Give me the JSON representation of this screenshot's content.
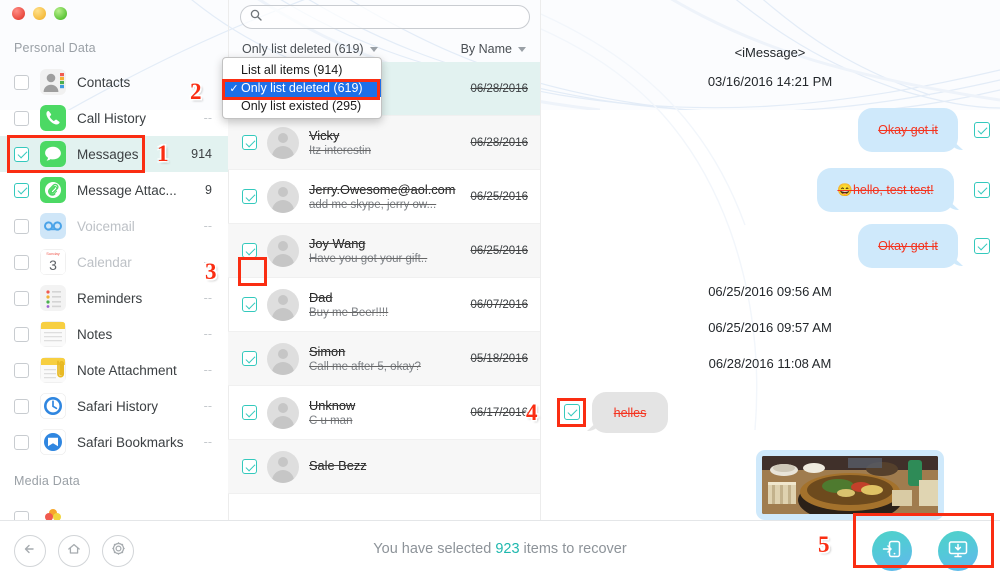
{
  "window": {
    "traffic_lights": [
      "close",
      "minimize",
      "zoom"
    ]
  },
  "sidebar": {
    "sections": [
      {
        "title": "Personal Data"
      },
      {
        "title": "Media Data"
      }
    ],
    "items": [
      {
        "label": "Contacts",
        "count": "",
        "checked": false,
        "dim": false,
        "icon": "contacts-icon"
      },
      {
        "label": "Call History",
        "count": "--",
        "checked": false,
        "dim": false,
        "icon": "call-history-icon"
      },
      {
        "label": "Messages",
        "count": "914",
        "checked": true,
        "dim": false,
        "icon": "messages-icon"
      },
      {
        "label": "Message Attac...",
        "count": "9",
        "checked": true,
        "dim": false,
        "icon": "message-attachment-icon"
      },
      {
        "label": "Voicemail",
        "count": "--",
        "checked": false,
        "dim": true,
        "icon": "voicemail-icon"
      },
      {
        "label": "Calendar",
        "count": "--",
        "checked": false,
        "dim": true,
        "icon": "calendar-icon"
      },
      {
        "label": "Reminders",
        "count": "--",
        "checked": false,
        "dim": false,
        "icon": "reminders-icon"
      },
      {
        "label": "Notes",
        "count": "--",
        "checked": false,
        "dim": false,
        "icon": "notes-icon"
      },
      {
        "label": "Note Attachment",
        "count": "--",
        "checked": false,
        "dim": false,
        "icon": "note-attachment-icon"
      },
      {
        "label": "Safari History",
        "count": "--",
        "checked": false,
        "dim": false,
        "icon": "safari-history-icon"
      },
      {
        "label": "Safari Bookmarks",
        "count": "--",
        "checked": false,
        "dim": false,
        "icon": "safari-bookmarks-icon"
      }
    ]
  },
  "search": {
    "value": "",
    "placeholder": ""
  },
  "filters": {
    "scope_label": "Only list deleted (619)",
    "sort_label": "By Name"
  },
  "dropdown": {
    "items": [
      {
        "label": "List all items (914)",
        "selected": false
      },
      {
        "label": "Only list deleted (619)",
        "selected": true
      },
      {
        "label": "Only list existed (295)",
        "selected": false
      }
    ]
  },
  "message_list": [
    {
      "name": "",
      "preview": "",
      "date": "06/28/2016",
      "checked": true
    },
    {
      "name": "Vicky",
      "preview": "Itz interestin",
      "date": "06/28/2016",
      "checked": true
    },
    {
      "name": "Jerry.Owesome@aol.com",
      "preview": "add me skype, jerry ow...",
      "date": "06/25/2016",
      "checked": true
    },
    {
      "name": "Joy Wang",
      "preview": "Have you got your gift..",
      "date": "06/25/2016",
      "checked": true
    },
    {
      "name": "Dad",
      "preview": "Buy me Beer!!!!",
      "date": "06/07/2016",
      "checked": true
    },
    {
      "name": "Simon",
      "preview": "Call me after 5, okay?",
      "date": "05/18/2016",
      "checked": true
    },
    {
      "name": "Unknow",
      "preview": "C u man",
      "date": "06/17/2016",
      "checked": true
    },
    {
      "name": "Sale Bezz",
      "preview": "",
      "date": "",
      "checked": true
    }
  ],
  "conversation": {
    "header": "<iMessage>",
    "entries": [
      {
        "kind": "timestamp",
        "text": "03/16/2016 14:21 PM"
      },
      {
        "kind": "bubble-out",
        "text": "Okay got it"
      },
      {
        "kind": "bubble-out",
        "text": "😄hello, test test!"
      },
      {
        "kind": "bubble-out",
        "text": "Okay got it"
      },
      {
        "kind": "timestamp",
        "text": "06/25/2016 09:56 AM"
      },
      {
        "kind": "timestamp",
        "text": "06/25/2016 09:57 AM"
      },
      {
        "kind": "timestamp",
        "text": "06/28/2016 11:08 AM"
      },
      {
        "kind": "bubble-in",
        "text": "helles"
      },
      {
        "kind": "photo",
        "text": ""
      }
    ]
  },
  "bottom": {
    "back_icon": "back-arrow-icon",
    "home_icon": "home-icon",
    "settings_icon": "gear-icon",
    "status_prefix": "You have selected ",
    "status_count": "923",
    "status_suffix": " items to recover",
    "recover_to_device_icon": "recover-to-device-icon",
    "recover_to_computer_icon": "recover-to-computer-icon"
  },
  "annotations": [
    {
      "number": "1"
    },
    {
      "number": "2"
    },
    {
      "number": "3"
    },
    {
      "number": "4"
    },
    {
      "number": "5"
    }
  ],
  "colors": {
    "accent_teal": "#1fb8ae",
    "annotation_red": "#fa2d12",
    "selection_blue": "#1d6fe8",
    "bubble_out": "#cfe9fb",
    "bubble_in": "#e4e4e4",
    "row_highlight": "#e2f2f0"
  }
}
